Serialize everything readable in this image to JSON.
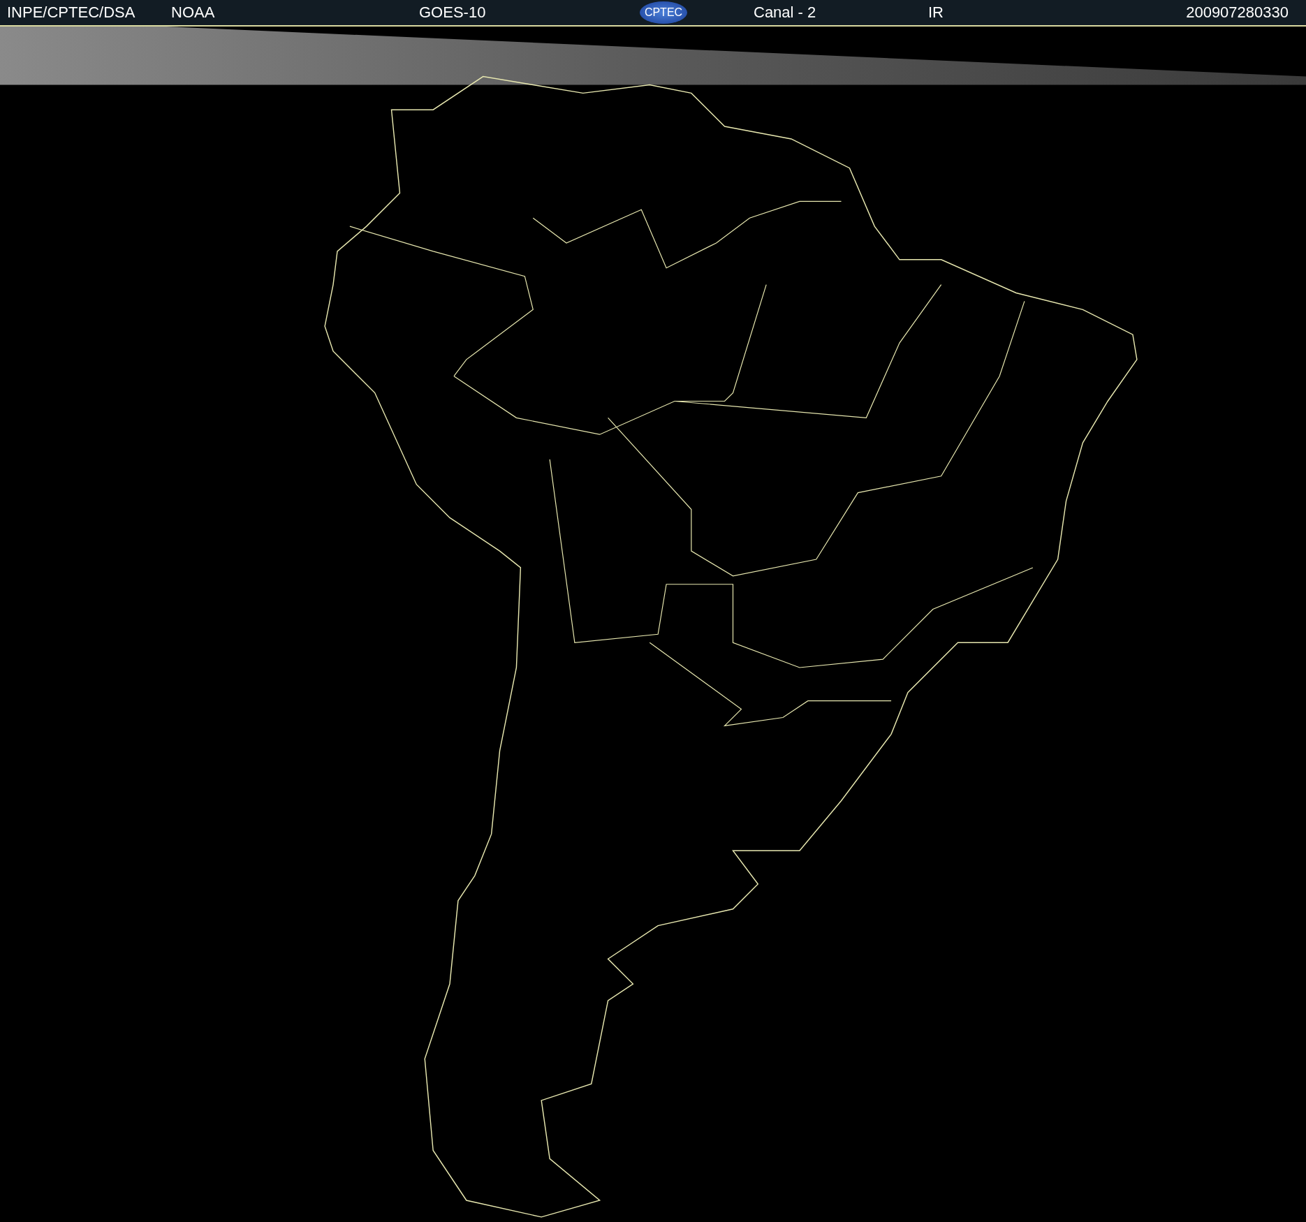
{
  "header": {
    "source": "INPE/CPTEC/DSA",
    "agency": "NOAA",
    "satellite": "GOES-10",
    "logo_text": "CPTEC",
    "channel": "Canal - 2",
    "band": "IR",
    "timestamp": "200907280330"
  }
}
